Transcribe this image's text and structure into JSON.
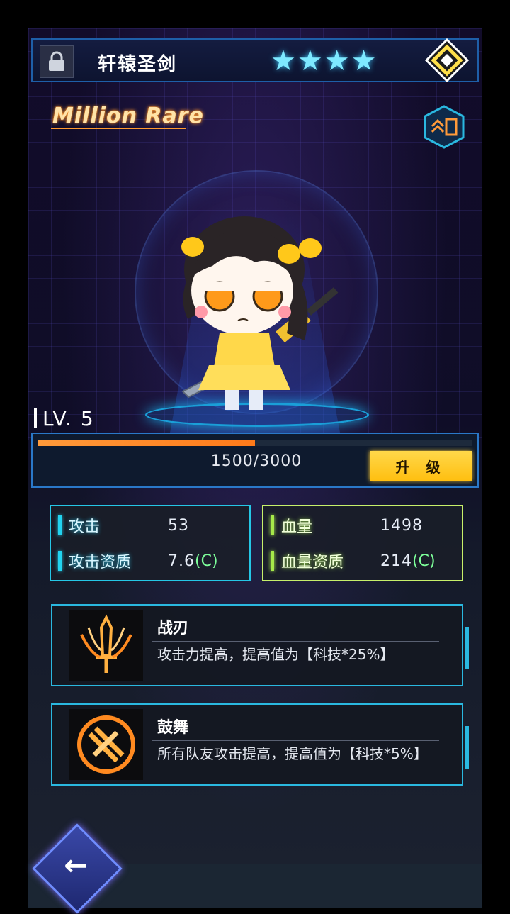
{
  "header": {
    "title": "轩辕圣剑",
    "star_count": 4,
    "star_glyph": "★",
    "lock_icon": "lock-icon",
    "emblem_icon": "diamond-emblem-icon"
  },
  "rarity": {
    "label": "Million Rare"
  },
  "skin_button": {
    "icon": "skin-toggle-icon"
  },
  "level": {
    "label": "LV. 5",
    "exp_current": 1500,
    "exp_max": 3000,
    "exp_text": "1500/3000",
    "upgrade_label": "升 级"
  },
  "stats": {
    "attack": {
      "label": "攻击",
      "value": "53",
      "quality_label": "攻击资质",
      "quality_value": "7.6",
      "quality_grade": "(C)"
    },
    "hp": {
      "label": "血量",
      "value": "1498",
      "quality_label": "血量资质",
      "quality_value": "214",
      "quality_grade": "(C)"
    }
  },
  "skills": [
    {
      "name": "战刃",
      "description": "攻击力提高，提高值为【科技*25%】",
      "icon": "sword-blade-icon"
    },
    {
      "name": "鼓舞",
      "description": "所有队友攻击提高，提高值为【科技*5%】",
      "icon": "crossed-swords-icon"
    }
  ],
  "back_button": {
    "icon": "back-arrow-icon"
  },
  "colors": {
    "accent_cyan": "#25c7e6",
    "accent_green": "#c7f06a",
    "upgrade_yellow": "#ffcc1a",
    "exp_orange": "#ff8a2a"
  }
}
